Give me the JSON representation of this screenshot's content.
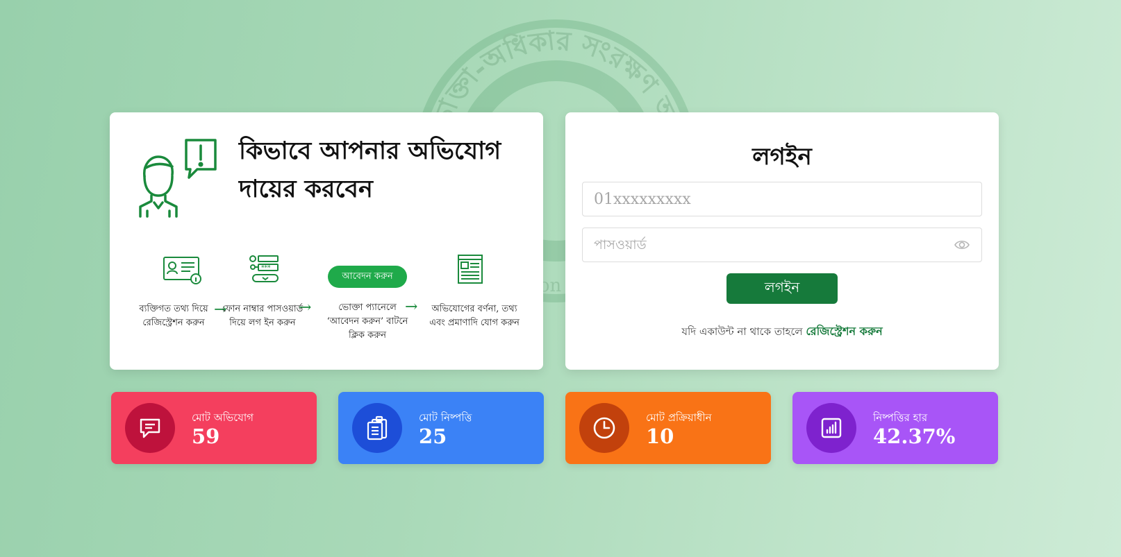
{
  "background": {
    "seal_text": "ভোক্তা-অধিকার সংরক্ষণ অ",
    "seal_text_lower": "Con"
  },
  "guide": {
    "title": "কিভাবে আপনার অভিযোগ দায়ের করবেন",
    "apply_button": "আবেদন করুন",
    "steps": [
      {
        "text": "ব্যক্তিগত তথ্য দিয়ে রেজিস্ট্রেশন করুন",
        "icon": "id-card-icon"
      },
      {
        "text": "ফোন নাম্বার পাসওয়ার্ড দিয়ে লগ ইন করুন",
        "icon": "login-form-icon"
      },
      {
        "text": "ভোক্তা প্যানেলে ‘আবেদন করুন’ বাটনে ক্লিক করুন",
        "icon": "apply-pill"
      },
      {
        "text": "অভিযোগের বর্ণনা, তথ্য এবং প্রমাণাদি যোগ করুন",
        "icon": "document-icon"
      }
    ],
    "arrow": "→"
  },
  "login": {
    "title": "লগইন",
    "phone_placeholder": "01xxxxxxxxx",
    "password_placeholder": "পাসওয়ার্ড",
    "button": "লগইন",
    "register_prompt": "যদি একাউন্ট না থাকে তাহলে",
    "register_link": "রেজিস্ট্রেশন করুন"
  },
  "stats": [
    {
      "label": "মোট অভিযোগ",
      "value": "59",
      "icon": "chat-icon",
      "color": "#f43f5e"
    },
    {
      "label": "মোট নিষ্পত্তি",
      "value": "25",
      "icon": "clipboard-icon",
      "color": "#3b82f6"
    },
    {
      "label": "মোট প্রক্রিয়াধীন",
      "value": "10",
      "icon": "clock-icon",
      "color": "#f97316"
    },
    {
      "label": "নিষ্পত্তির হার",
      "value": "42.37%",
      "icon": "bar-chart-icon",
      "color": "#a855f7"
    }
  ],
  "colors": {
    "brand_green": "#167a3b",
    "pill_green": "#1faa4a"
  }
}
